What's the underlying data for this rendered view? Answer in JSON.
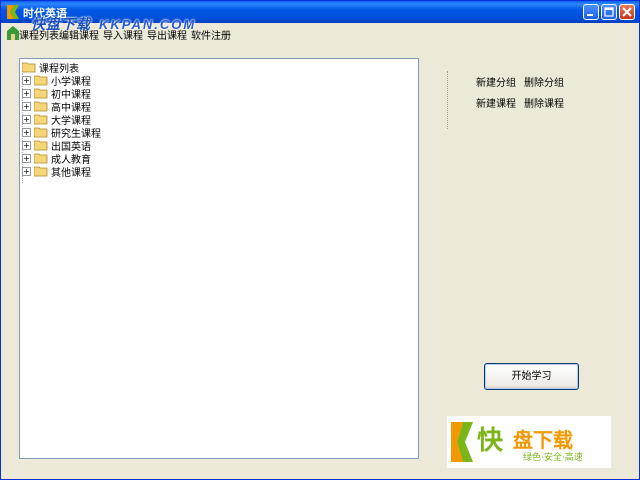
{
  "window": {
    "title": "时代英语",
    "watermark": "快盘下载",
    "watermark_url": "KKPAN.COM"
  },
  "menu": {
    "items": [
      "课程列表",
      "编辑课程",
      "导入课程",
      "导出课程",
      "软件注册"
    ]
  },
  "tree": {
    "root_label": "课程列表",
    "nodes": [
      "小学课程",
      "初中课程",
      "高中课程",
      "大学课程",
      "研究生课程",
      "出国英语",
      "成人教育",
      "其他课程"
    ]
  },
  "actions": {
    "new_group": "新建分组",
    "delete_group": "删除分组",
    "new_course": "新建课程",
    "delete_course": "删除课程",
    "start": "开始学习"
  },
  "logo": {
    "char": "快",
    "name": "盘下载",
    "slogan": "绿色·安全·高速"
  },
  "colors": {
    "titlebar": "#0058e6",
    "logo_green": "#7cb518",
    "logo_orange": "#f39800"
  }
}
